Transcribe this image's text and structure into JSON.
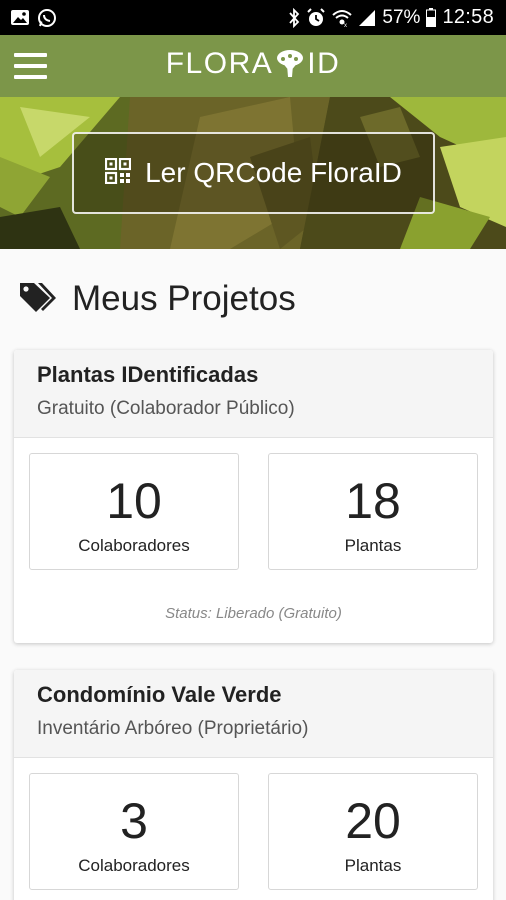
{
  "status_bar": {
    "battery": "57%",
    "time": "12:58"
  },
  "app_bar": {
    "brand_left": "FLORA",
    "brand_right": "ID"
  },
  "banner": {
    "qr_button_label": "Ler QRCode FloraID"
  },
  "section": {
    "title": "Meus Projetos"
  },
  "projects": [
    {
      "title": "Plantas IDentificadas",
      "subtitle": "Gratuito (Colaborador Público)",
      "collaborators": "10",
      "collaborators_label": "Colaboradores",
      "plants": "18",
      "plants_label": "Plantas",
      "status": "Status: Liberado (Gratuito)"
    },
    {
      "title": "Condomínio Vale Verde",
      "subtitle": "Inventário Arbóreo (Proprietário)",
      "collaborators": "3",
      "collaborators_label": "Colaboradores",
      "plants": "20",
      "plants_label": "Plantas"
    }
  ],
  "colors": {
    "app_bar": "#7c9649",
    "status_bar": "#000000"
  }
}
